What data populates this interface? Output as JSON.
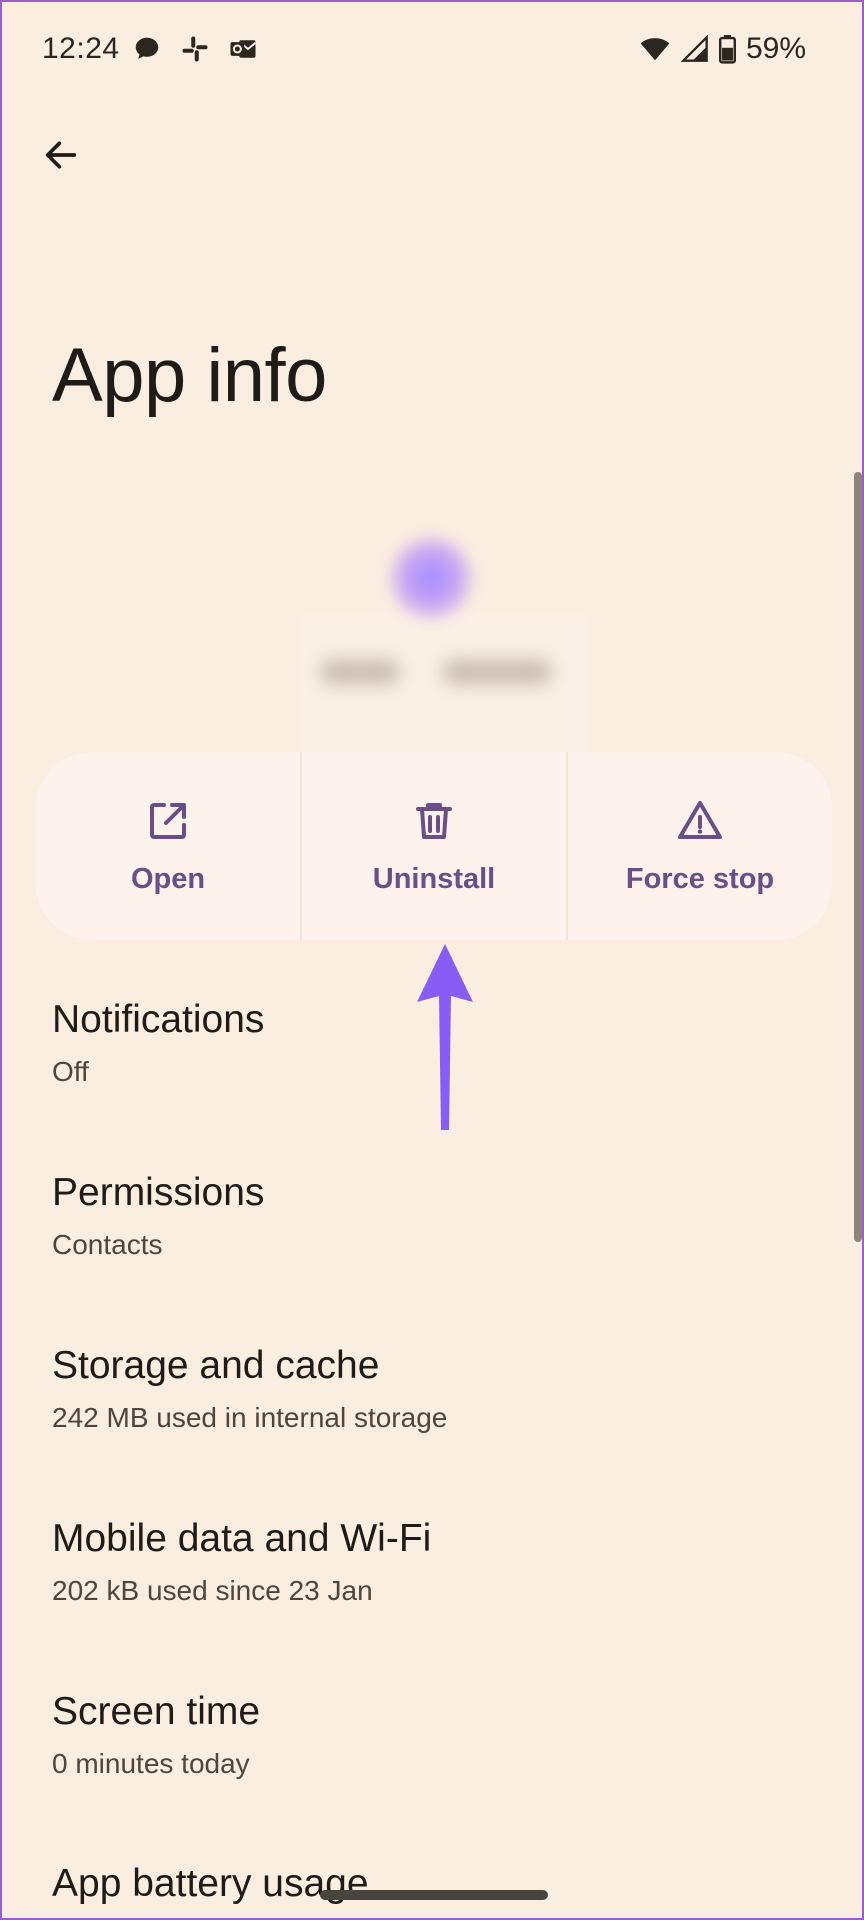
{
  "status_bar": {
    "time": "12:24",
    "battery": "59%",
    "notification_icons": [
      "chat-bubble-icon",
      "slack-icon",
      "outlook-icon"
    ],
    "system_icons": [
      "wifi-icon",
      "cellular-signal-icon",
      "battery-icon"
    ]
  },
  "header": {
    "back_icon": "arrow-back-icon",
    "title": "App info"
  },
  "actions": [
    {
      "label": "Open",
      "icon": "open-external-icon"
    },
    {
      "label": "Uninstall",
      "icon": "trash-icon"
    },
    {
      "label": "Force stop",
      "icon": "warning-triangle-icon"
    }
  ],
  "settings": [
    {
      "title": "Notifications",
      "subtitle": "Off"
    },
    {
      "title": "Permissions",
      "subtitle": "Contacts"
    },
    {
      "title": "Storage and cache",
      "subtitle": "242 MB used in internal storage"
    },
    {
      "title": "Mobile data and Wi-Fi",
      "subtitle": "202 kB used since 23 Jan"
    },
    {
      "title": "Screen time",
      "subtitle": "0 minutes today"
    },
    {
      "title": "App battery usage"
    }
  ],
  "colors": {
    "background": "#faeee0",
    "card": "#fdf3ec",
    "accent": "#6a4e88",
    "annotation_arrow": "#8a5cf6"
  }
}
